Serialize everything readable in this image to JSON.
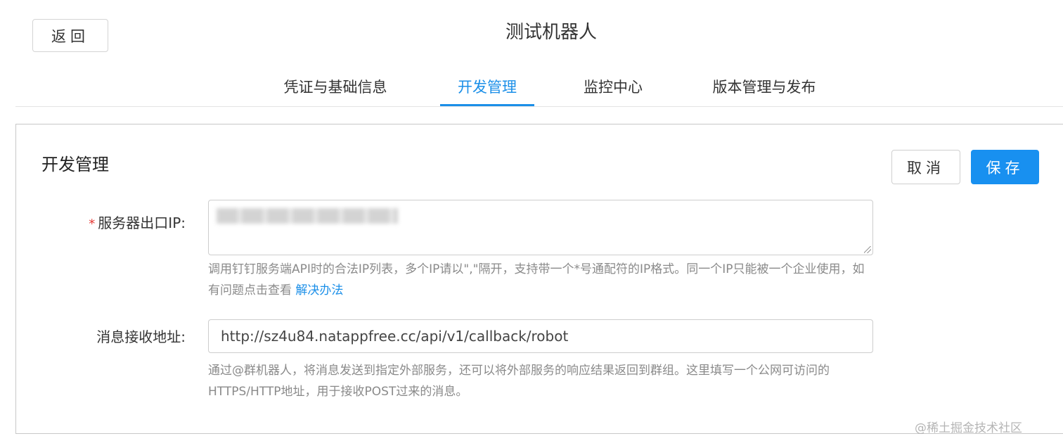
{
  "header": {
    "back_label": "返回",
    "title": "测试机器人"
  },
  "tabs": [
    {
      "label": "凭证与基础信息",
      "active": false
    },
    {
      "label": "开发管理",
      "active": true
    },
    {
      "label": "监控中心",
      "active": false
    },
    {
      "label": "版本管理与发布",
      "active": false
    }
  ],
  "section": {
    "title": "开发管理",
    "cancel_label": "取消",
    "save_label": "保存"
  },
  "form": {
    "ip_field": {
      "required_mark": "*",
      "label": "服务器出口IP:",
      "value_redacted": true,
      "help_text": "调用钉钉服务端API时的合法IP列表，多个IP请以\",\"隔开，支持带一个*号通配符的IP格式。同一个IP只能被一个企业使用，如有问题点击查看",
      "help_link": "解决办法"
    },
    "callback_field": {
      "label": "消息接收地址:",
      "value": "http://sz4u84.natappfree.cc/api/v1/callback/robot",
      "help_text": "通过@群机器人，将消息发送到指定外部服务，还可以将外部服务的响应结果返回到群组。这里填写一个公网可访问的HTTPS/HTTP地址，用于接收POST过来的消息。"
    }
  },
  "watermark": "@稀土掘金技术社区",
  "colors": {
    "accent": "#1890f0",
    "required": "#e53935",
    "help_text": "#8a8a8a"
  }
}
